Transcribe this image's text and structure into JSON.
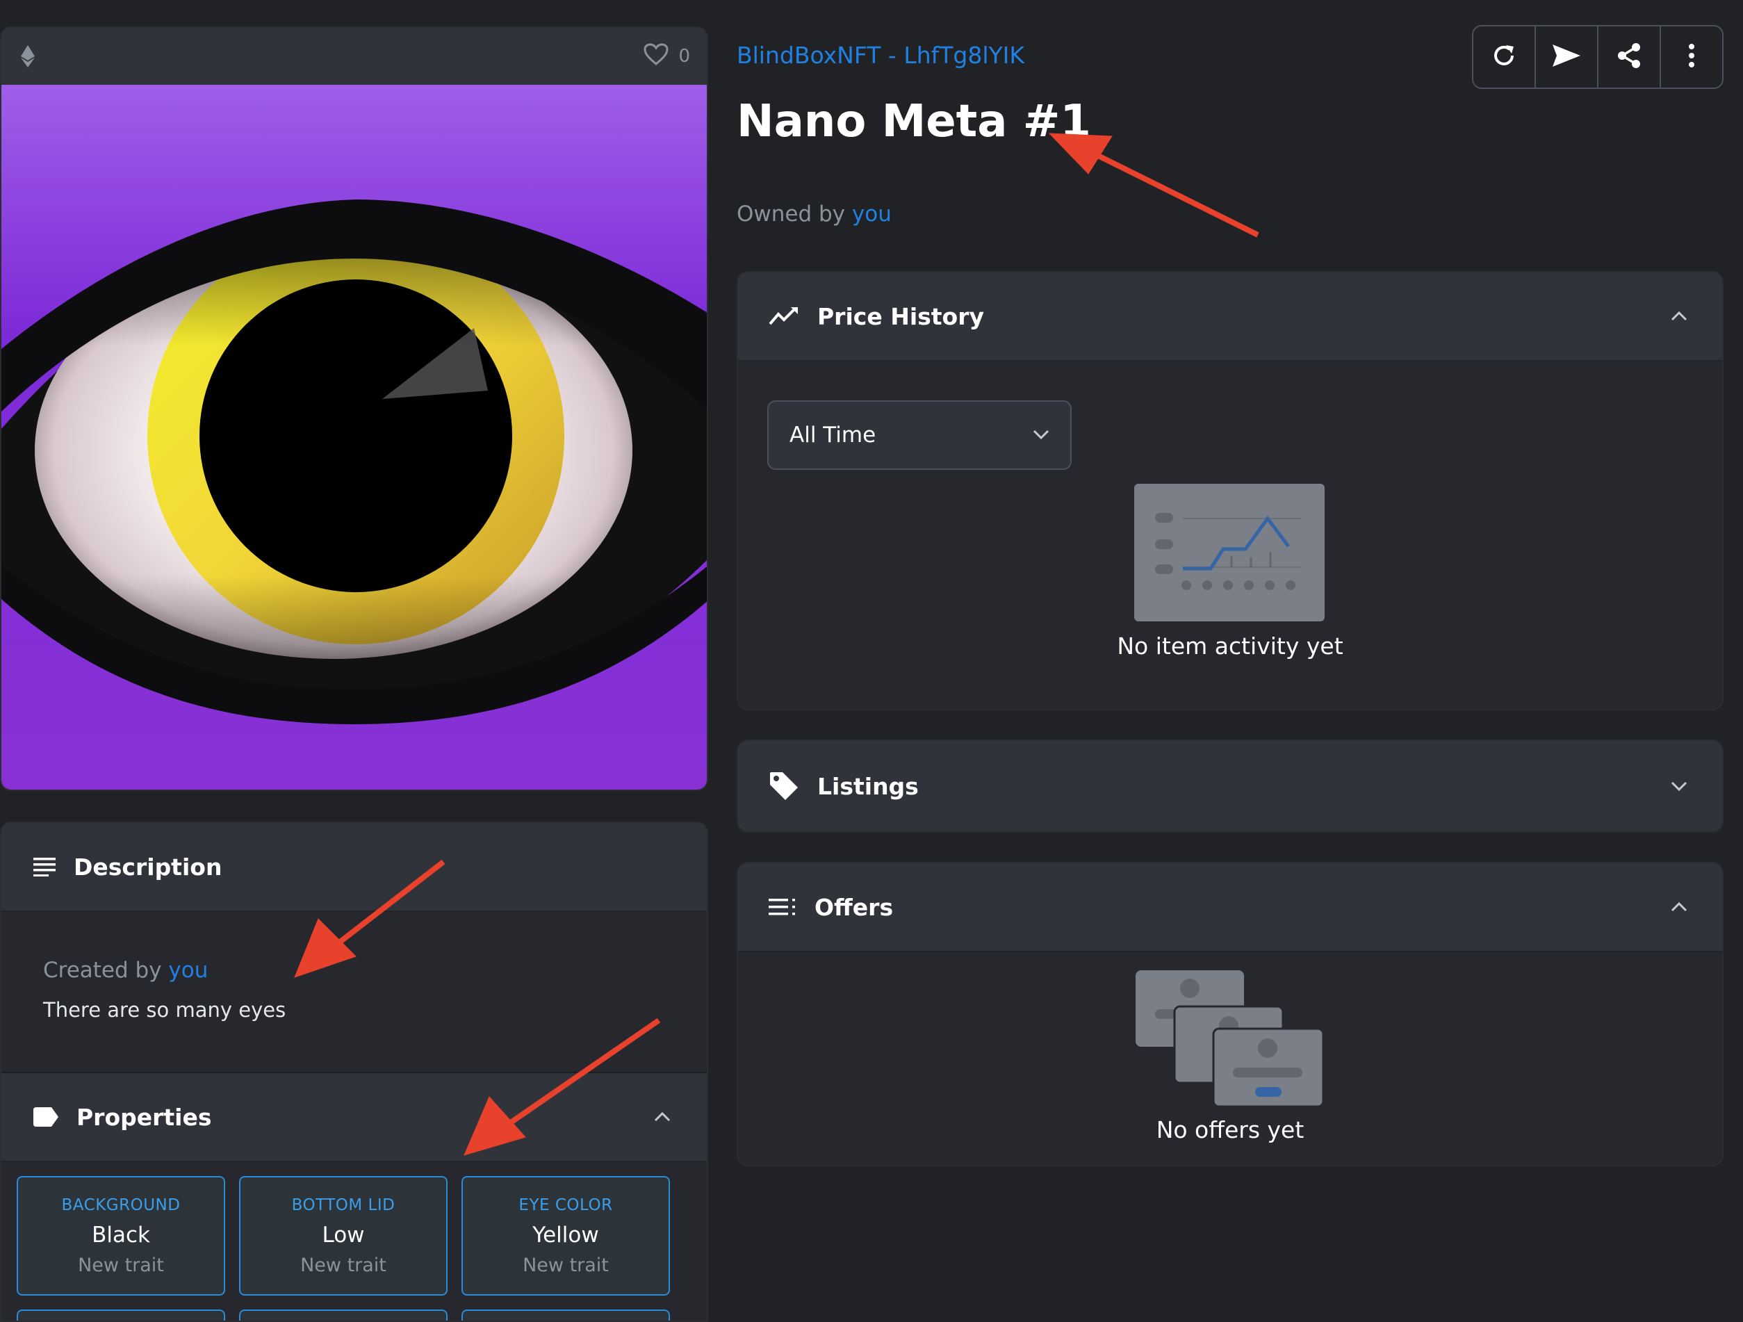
{
  "media": {
    "like_count": "0",
    "chain_icon": "ethereum-icon",
    "favorite_icon": "heart-icon"
  },
  "description": {
    "title": "Description",
    "created_prefix": "Created by",
    "creator": "you",
    "text": "There are so many eyes"
  },
  "properties": {
    "title": "Properties",
    "traits": [
      {
        "type": "BACKGROUND",
        "value": "Black",
        "rarity": "New trait"
      },
      {
        "type": "BOTTOM LID",
        "value": "Low",
        "rarity": "New trait"
      },
      {
        "type": "EYE COLOR",
        "value": "Yellow",
        "rarity": "New trait"
      }
    ]
  },
  "item": {
    "collection": "BlindBoxNFT - LhfTg8lYIK",
    "title": "Nano Meta #1",
    "owned_prefix": "Owned by",
    "owner": "you"
  },
  "actions": [
    "refresh-icon",
    "send-icon",
    "share-icon",
    "more-icon"
  ],
  "price_history": {
    "title": "Price History",
    "filter": "All Time",
    "empty": "No item activity yet"
  },
  "listings": {
    "title": "Listings"
  },
  "offers": {
    "title": "Offers",
    "empty": "No offers yet"
  },
  "colors": {
    "background": "#202225",
    "panel": "#303339",
    "link": "#2081e2",
    "trait_border": "#2a8bd9",
    "annotation": "#e8412c"
  }
}
